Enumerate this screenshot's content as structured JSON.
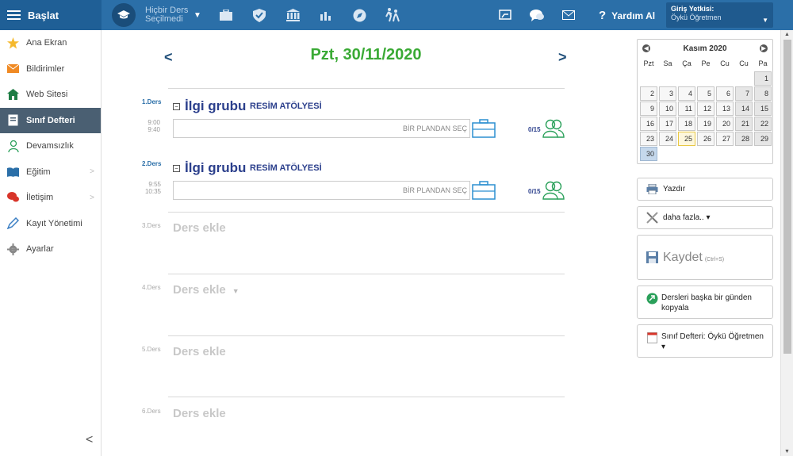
{
  "topbar": {
    "menu_label": "Başlat",
    "context": "Hiçbir Ders Seçilmedi",
    "help_label": "Yardım Al",
    "login_title": "Giriş Yetkisi:",
    "login_user": "Öykü Öğretmen",
    "icons": [
      "briefcase-icon",
      "shield-icon",
      "institution-icon",
      "bar-chart-icon",
      "compass-icon",
      "walking-icon"
    ],
    "right_icons": [
      "cast-icon",
      "chat-icon",
      "mail-icon"
    ]
  },
  "sidebar": {
    "items": [
      {
        "label": "Ana Ekran",
        "icon": "star-icon"
      },
      {
        "label": "Bildirimler",
        "icon": "envelope-icon"
      },
      {
        "label": "Web Sitesi",
        "icon": "home-icon"
      },
      {
        "label": "Sınıf Defteri",
        "icon": "notebook-icon"
      },
      {
        "label": "Devamsızlık",
        "icon": "person-icon"
      },
      {
        "label": "Eğitim",
        "icon": "book-icon"
      },
      {
        "label": "İletişim",
        "icon": "chat-icon"
      },
      {
        "label": "Kayıt Yönetimi",
        "icon": "pen-icon"
      },
      {
        "label": "Ayarlar",
        "icon": "gear-icon"
      }
    ]
  },
  "main": {
    "date": "Pzt, 30/11/2020",
    "lessons": [
      {
        "num": "1.Ders",
        "start": "9:00",
        "end": "9:40",
        "group": "İlgi grubu",
        "subject": "RESİM ATÖLYESİ",
        "plan_label": "BİR PLANDAN SEÇ",
        "count": "0/15"
      },
      {
        "num": "2.Ders",
        "start": "9:55",
        "end": "10:35",
        "group": "İlgi grubu",
        "subject": "RESİM ATÖLYESİ",
        "plan_label": "BİR PLANDAN SEÇ",
        "count": "0/15"
      },
      {
        "num": "3.Ders",
        "add_label": "Ders ekle"
      },
      {
        "num": "4.Ders",
        "add_label": "Ders ekle"
      },
      {
        "num": "5.Ders",
        "add_label": "Ders ekle"
      },
      {
        "num": "6.Ders",
        "add_label": "Ders ekle"
      }
    ]
  },
  "calendar": {
    "month": "Kasım 2020",
    "day_names": [
      "Pzt",
      "Sa",
      "Ça",
      "Pe",
      "Cu",
      "Cu",
      "Pa"
    ],
    "weeks": [
      [
        "",
        "",
        "",
        "",
        "",
        "",
        "1"
      ],
      [
        "2",
        "3",
        "4",
        "5",
        "6",
        "7",
        "8"
      ],
      [
        "9",
        "10",
        "11",
        "12",
        "13",
        "14",
        "15"
      ],
      [
        "16",
        "17",
        "18",
        "19",
        "20",
        "21",
        "22"
      ],
      [
        "23",
        "24",
        "25",
        "26",
        "27",
        "28",
        "29"
      ],
      [
        "30",
        "",
        "",
        "",
        "",
        "",
        ""
      ]
    ],
    "today": "25",
    "selected": "30"
  },
  "actions": {
    "print": "Yazdır",
    "more": "daha fazla.. ▾",
    "save": "Kaydet",
    "save_shortcut": "(Ctrl+S)",
    "copy": "Dersleri başka bir günden kopyala",
    "notebook": "Sınıf Defteri: Öykü Öğretmen ▾"
  },
  "colors": {
    "topbar": "#2b6fa8",
    "date_green": "#3aaa35",
    "group_blue": "#2b3f8c"
  }
}
